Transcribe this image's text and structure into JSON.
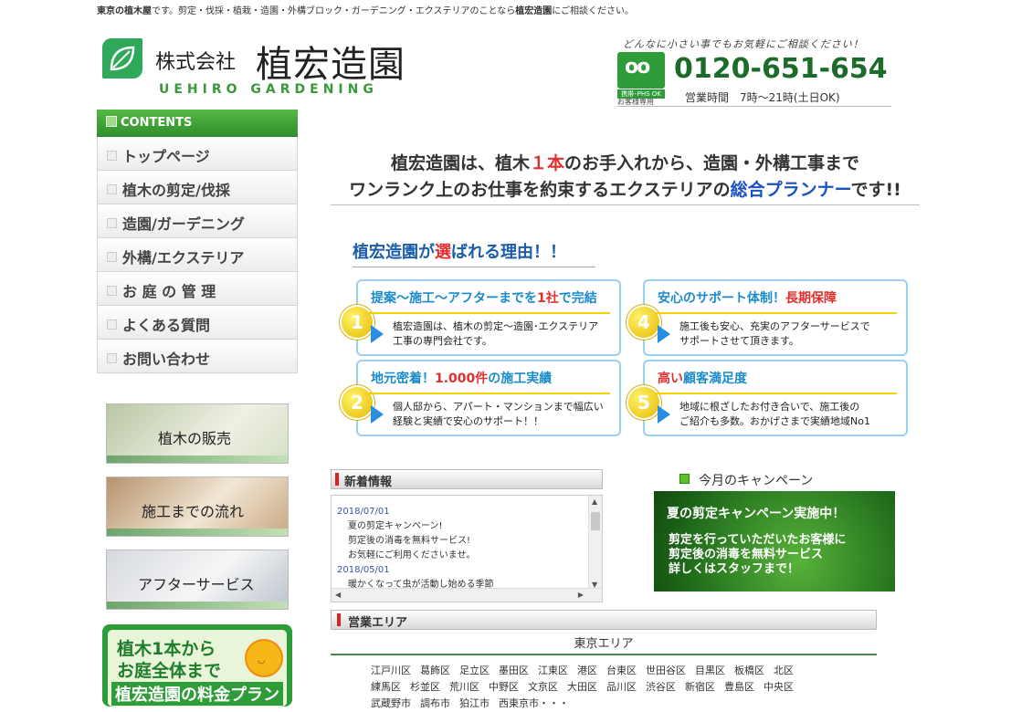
{
  "topline": {
    "p1": "東京の",
    "b1": "植木屋",
    "p2": "です。剪定・伐採・植栽・造園・外構ブロック・ガーデニング・エクステリアのことなら",
    "b2": "植宏造園",
    "p3": "にご相談ください。"
  },
  "logo": {
    "company": "株式会社",
    "name": "植宏造園",
    "english": "UEHIRO GARDENING"
  },
  "phone": {
    "tagline": "どんなに小さい事でもお気軽にご相談ください！",
    "freedial": "oo",
    "phs": "携帯･PHS OK",
    "customer": "お客様専用",
    "number": "0120-651-654",
    "hours": "営業時間　7時～21時(土日OK)"
  },
  "sidebar": {
    "contents_label": "CONTENTS",
    "items": [
      {
        "label": "トップページ"
      },
      {
        "label": "植木の剪定/伐採"
      },
      {
        "label": "造園/ガーデニング"
      },
      {
        "label": "外構/エクステリア"
      },
      {
        "label": "お 庭 の 管 理"
      },
      {
        "label": "よくある質問"
      },
      {
        "label": "お問い合わせ"
      }
    ],
    "banners": [
      {
        "label": "植木の販売"
      },
      {
        "label": "施工までの流れ"
      },
      {
        "label": "アフターサービス"
      }
    ],
    "plan": {
      "line1": "植木1本から",
      "line2": "お庭全体まで",
      "line3": "植宏造園の料金プラン"
    }
  },
  "headline": {
    "l1a": "植宏造園は、植木",
    "l1b": "１本",
    "l1c": "のお手入れから、造園・外構工事まで",
    "l2a": "ワンランク上のお仕事を約束するエクステリアの",
    "l2b": "総合プランナー",
    "l2c": "です!!"
  },
  "reasons": {
    "title_a": "植宏造園が",
    "title_b": "選",
    "title_c": "ばれる理由！！",
    "items": [
      {
        "num": "1",
        "title_a": "提案～施工～アフターまでを",
        "title_b": "1社",
        "title_c": "で完結",
        "text1": "植宏造園は、植木の剪定～造園･エクステリア",
        "text2": "工事の専門会社です。"
      },
      {
        "num": "2",
        "title_a": "地元密着！",
        "title_b": "1.000件",
        "title_c": "の施工実績",
        "text1": "個人邸から、アパート・マンションまで幅広い",
        "text2": "経験と実績で安心のサポート！！"
      },
      {
        "num": "4",
        "title_a": "安心のサポート体制！",
        "title_b": "長期保障",
        "title_c": "",
        "text1": "施工後も安心、充実のアフターサービスで",
        "text2": "サポートさせて頂きます。"
      },
      {
        "num": "5",
        "title_a": "",
        "title_b": "高い",
        "title_c": "顧客満足度",
        "text1": "地域に根ざしたお付き合いで、施工後の",
        "text2": "ご紹介も多数。おかげさまで実績地域No1"
      }
    ]
  },
  "news": {
    "label": "新着情報",
    "entries": [
      {
        "date": "2018/07/01",
        "lines": [
          "夏の剪定キャンペーン!",
          "剪定後の消毒を無料サービス!",
          "お気軽にご利用くださいませ。"
        ]
      },
      {
        "date": "2018/05/01",
        "lines": [
          "暖かくなって虫が活動し始める季節"
        ]
      }
    ]
  },
  "campaign": {
    "label": "今月のキャンペーン",
    "title": "夏の剪定キャンペーン実施中！",
    "line1": "剪定を行っていただいたお客様に",
    "line2": "剪定後の消毒を無料サービス",
    "line3": "詳しくはスタッフまで！"
  },
  "area": {
    "label": "営業エリア",
    "tokyo": "東京エリア",
    "rows": [
      [
        "江戸川区",
        "葛飾区",
        "足立区",
        "墨田区",
        "江東区",
        "港区",
        "台東区",
        "世田谷区",
        "目黒区",
        "板橋区",
        "北区"
      ],
      [
        "練馬区",
        "杉並区",
        "荒川区",
        "中野区",
        "文京区",
        "大田区",
        "品川区",
        "渋谷区",
        "新宿区",
        "豊島区",
        "中央区"
      ],
      [
        "武蔵野市",
        "調布市",
        "狛江市",
        "西東京市・・・"
      ]
    ]
  },
  "colors": {
    "brand_green": "#2f9c3a",
    "accent_red": "#e03030",
    "accent_blue": "#1a52c0"
  }
}
